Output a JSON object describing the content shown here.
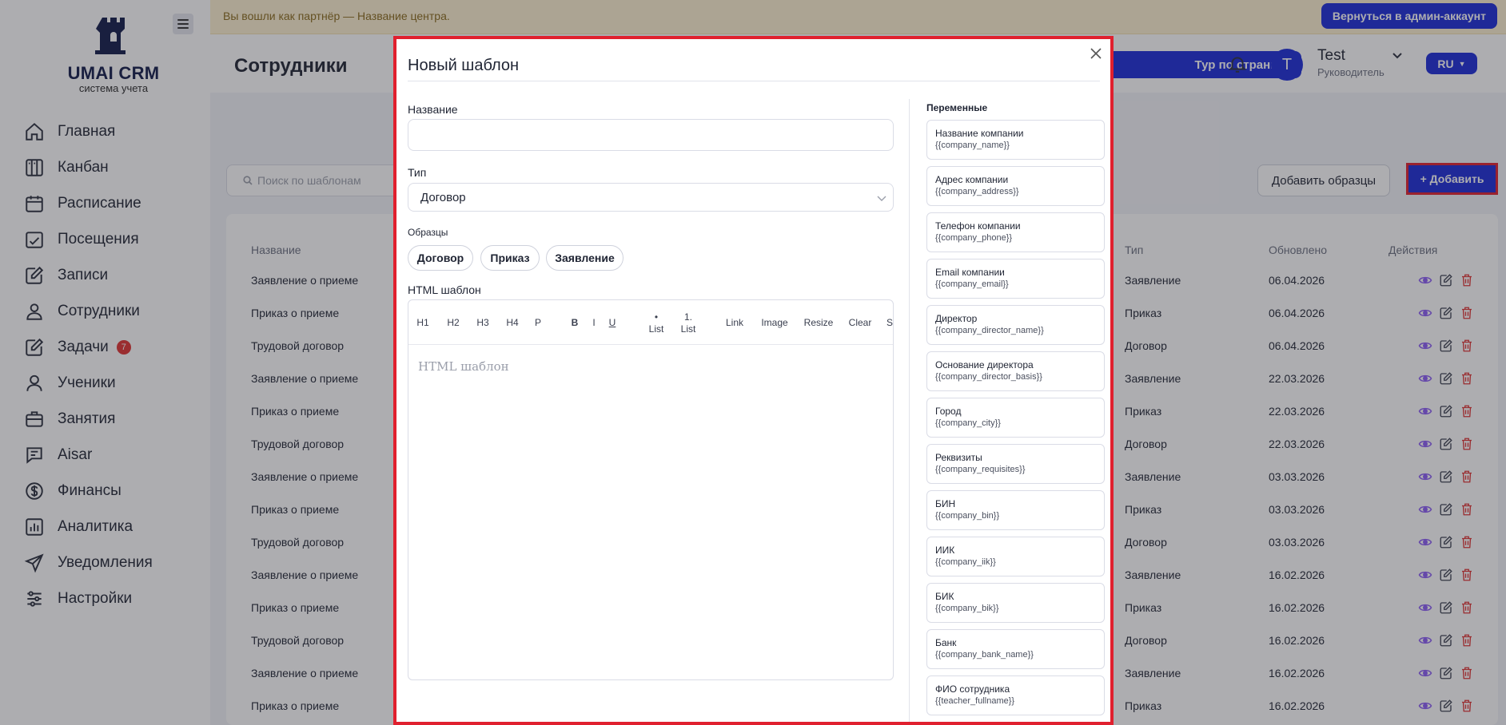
{
  "banner": {
    "text": "Вы вошли как партнёр — Название центра.",
    "back_button": "Вернуться в админ-аккаунт"
  },
  "logo": {
    "title": "UMAI CRM",
    "subtitle": "система учета"
  },
  "sidebar": {
    "items": [
      {
        "label": "Главная",
        "icon": "home-icon"
      },
      {
        "label": "Канбан",
        "icon": "kanban-icon"
      },
      {
        "label": "Расписание",
        "icon": "calendar-icon"
      },
      {
        "label": "Посещения",
        "icon": "calendar-check-icon"
      },
      {
        "label": "Записи",
        "icon": "edit-icon"
      },
      {
        "label": "Сотрудники",
        "icon": "users-icon"
      },
      {
        "label": "Задачи",
        "icon": "tasks-icon",
        "badge": "7"
      },
      {
        "label": "Ученики",
        "icon": "user-icon"
      },
      {
        "label": "Занятия",
        "icon": "briefcase-icon"
      },
      {
        "label": "Aisar",
        "icon": "chat-icon"
      },
      {
        "label": "Финансы",
        "icon": "dollar-icon"
      },
      {
        "label": "Аналитика",
        "icon": "chart-icon"
      },
      {
        "label": "Уведомления",
        "icon": "send-icon"
      },
      {
        "label": "Настройки",
        "icon": "sliders-icon"
      }
    ]
  },
  "header": {
    "page_title": "Сотрудники",
    "tour_button": "Тур по странице",
    "user": {
      "initial": "T",
      "name": "Test",
      "role": "Руководитель"
    },
    "lang": "RU"
  },
  "toolbar": {
    "search_placeholder": "Поиск по шаблонам",
    "samples_button": "Добавить образцы",
    "add_button": "+ Добавить"
  },
  "table": {
    "columns": {
      "name": "Название",
      "type": "Тип",
      "updated": "Обновлено",
      "actions": "Действия"
    },
    "rows": [
      {
        "name": "Заявление о приеме",
        "type": "Заявление",
        "updated": "06.04.2026"
      },
      {
        "name": "Приказ о приеме",
        "type": "Приказ",
        "updated": "06.04.2026"
      },
      {
        "name": "Трудовой договор",
        "type": "Договор",
        "updated": "06.04.2026"
      },
      {
        "name": "Заявление о приеме",
        "type": "Заявление",
        "updated": "22.03.2026"
      },
      {
        "name": "Приказ о приеме",
        "type": "Приказ",
        "updated": "22.03.2026"
      },
      {
        "name": "Трудовой договор",
        "type": "Договор",
        "updated": "22.03.2026"
      },
      {
        "name": "Заявление о приеме",
        "type": "Заявление",
        "updated": "03.03.2026"
      },
      {
        "name": "Приказ о приеме",
        "type": "Приказ",
        "updated": "03.03.2026"
      },
      {
        "name": "Трудовой договор",
        "type": "Договор",
        "updated": "03.03.2026"
      },
      {
        "name": "Заявление о приеме",
        "type": "Заявление",
        "updated": "16.02.2026"
      },
      {
        "name": "Приказ о приеме",
        "type": "Приказ",
        "updated": "16.02.2026"
      },
      {
        "name": "Трудовой договор",
        "type": "Договор",
        "updated": "16.02.2026"
      },
      {
        "name": "Заявление о приеме",
        "type": "Заявление",
        "updated": "16.02.2026"
      },
      {
        "name": "Приказ о приеме",
        "type": "Приказ",
        "updated": "16.02.2026"
      }
    ]
  },
  "modal": {
    "title": "Новый шаблон",
    "name_label": "Название",
    "name_value": "",
    "type_label": "Тип",
    "type_value": "Договор",
    "samples_label": "Образцы",
    "samples": [
      "Договор",
      "Приказ",
      "Заявление"
    ],
    "html_label": "HTML шаблон",
    "editor_placeholder": "HTML шаблон",
    "editor_toolbar": [
      "H1",
      "H2",
      "H3",
      "H4",
      "P",
      "B",
      "I",
      "U",
      "• List",
      "1. List",
      "Link",
      "Image",
      "Resize",
      "Clear",
      "S"
    ],
    "variables_title": "Переменные",
    "variables": [
      {
        "name": "Название компании",
        "code": "{{company_name}}"
      },
      {
        "name": "Адрес компании",
        "code": "{{company_address}}"
      },
      {
        "name": "Телефон компании",
        "code": "{{company_phone}}"
      },
      {
        "name": "Email компании",
        "code": "{{company_email}}"
      },
      {
        "name": "Директор",
        "code": "{{company_director_name}}"
      },
      {
        "name": "Основание директора",
        "code": "{{company_director_basis}}"
      },
      {
        "name": "Город",
        "code": "{{company_city}}"
      },
      {
        "name": "Реквизиты",
        "code": "{{company_requisites}}"
      },
      {
        "name": "БИН",
        "code": "{{company_bin}}"
      },
      {
        "name": "ИИК",
        "code": "{{company_iik}}"
      },
      {
        "name": "БИК",
        "code": "{{company_bik}}"
      },
      {
        "name": "Банк",
        "code": "{{company_bank_name}}"
      },
      {
        "name": "ФИО сотрудника",
        "code": "{{teacher_fullname}}"
      }
    ]
  },
  "colors": {
    "brand": "#1a2ad8",
    "highlight": "#e0202e",
    "view_icon": "#8b5cf6",
    "delete_icon": "#e03131"
  }
}
